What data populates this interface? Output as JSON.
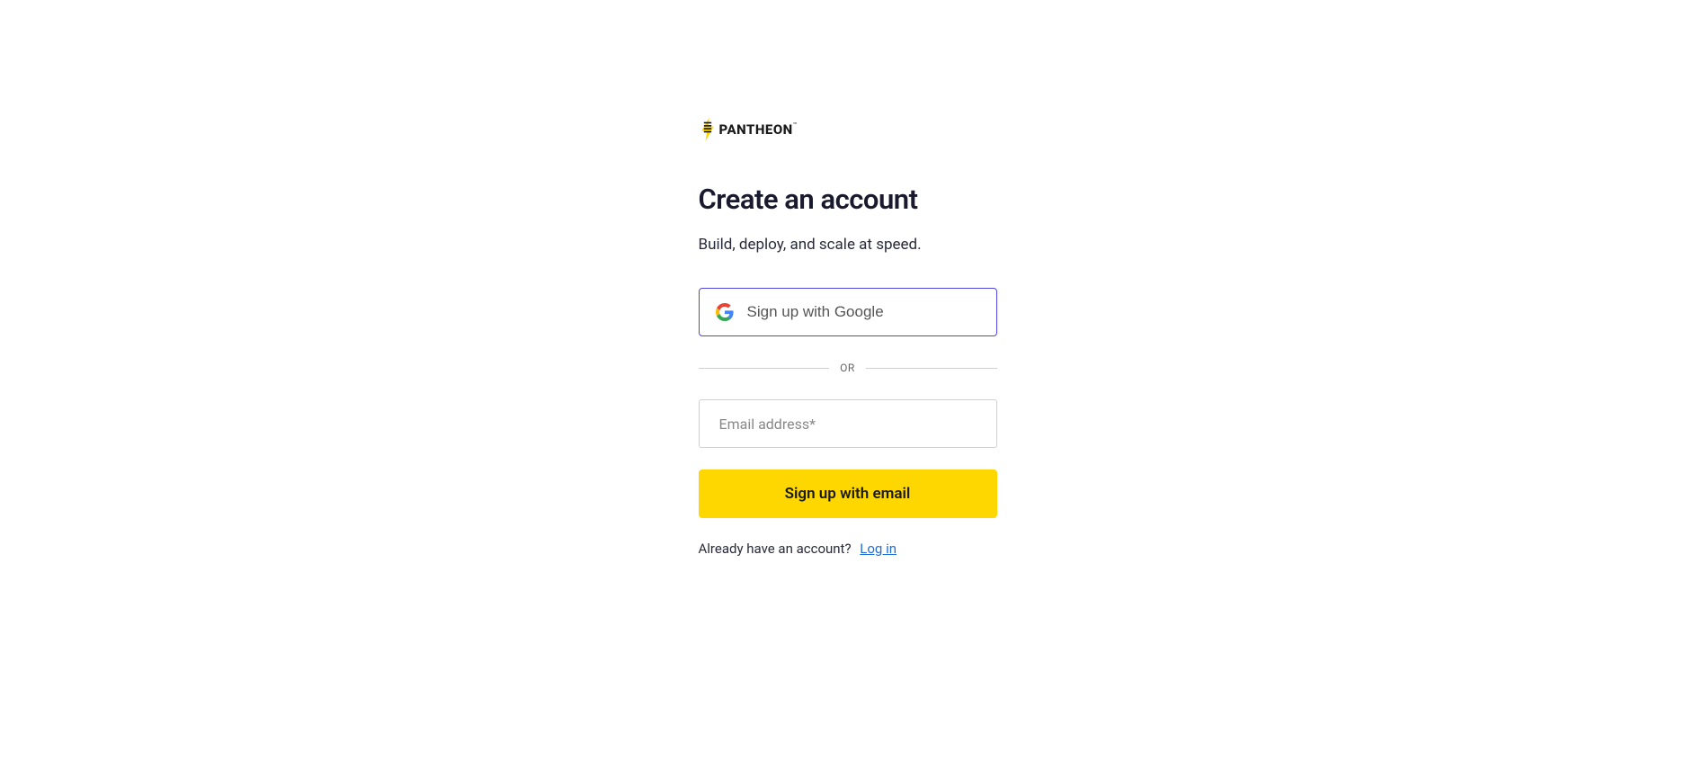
{
  "logo": {
    "brand_name": "PANTHEON"
  },
  "heading": "Create an account",
  "subtitle": "Build, deploy, and scale at speed.",
  "google_button": "Sign up with Google",
  "divider_text": "OR",
  "email_placeholder": "Email address*",
  "signup_button": "Sign up with email",
  "login_prompt": "Already have an account?",
  "login_link": "Log in"
}
